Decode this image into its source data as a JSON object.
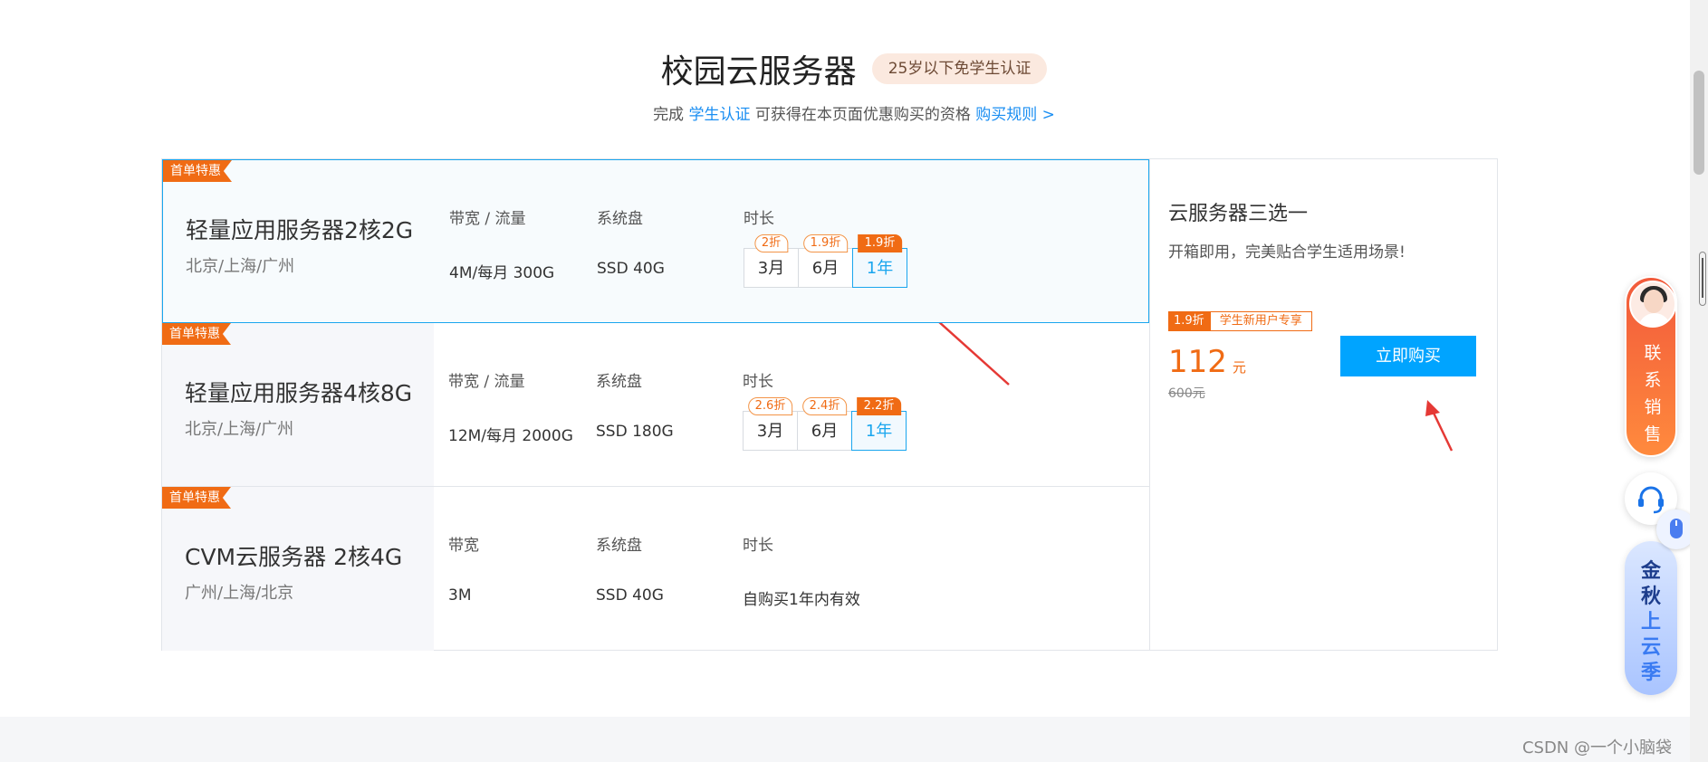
{
  "header": {
    "title": "校园云服务器",
    "age_badge": "25岁以下免学生认证",
    "subtitle_prefix": "完成",
    "subtitle_link": "学生认证",
    "subtitle_middle": "可获得在本页面优惠购买的资格",
    "rules_link": "购买规则 >"
  },
  "products": [
    {
      "ribbon": "首单特惠",
      "name": "轻量应用服务器2核2G",
      "region": "北京/上海/广州",
      "bandwidth_header": "带宽 / 流量",
      "bandwidth_value": "4M/每月 300G",
      "disk_header": "系统盘",
      "disk_value": "SSD 40G",
      "duration_header": "时长",
      "durations": [
        {
          "label": "3月",
          "discount": "2折"
        },
        {
          "label": "6月",
          "discount": "1.9折"
        },
        {
          "label": "1年",
          "discount": "1.9折"
        }
      ]
    },
    {
      "ribbon": "首单特惠",
      "name": "轻量应用服务器4核8G",
      "region": "北京/上海/广州",
      "bandwidth_header": "带宽 / 流量",
      "bandwidth_value": "12M/每月 2000G",
      "disk_header": "系统盘",
      "disk_value": "SSD 180G",
      "duration_header": "时长",
      "durations": [
        {
          "label": "3月",
          "discount": "2.6折"
        },
        {
          "label": "6月",
          "discount": "2.4折"
        },
        {
          "label": "1年",
          "discount": "2.2折"
        }
      ]
    },
    {
      "ribbon": "首单特惠",
      "name": "CVM云服务器 2核4G",
      "region": "广州/上海/北京",
      "bandwidth_header": "带宽",
      "bandwidth_value": "3M",
      "disk_header": "系统盘",
      "disk_value": "SSD 40G",
      "duration_header": "时长",
      "duration_value": "自购买1年内有效"
    }
  ],
  "side": {
    "title": "云服务器三选一",
    "desc": "开箱即用，完美贴合学生适用场景!",
    "tag_discount": "1.9折",
    "tag_user": "学生新用户专享",
    "price": "112",
    "price_unit": "元",
    "old_price": "600元",
    "buy_button": "立即购买"
  },
  "floating": {
    "sales_text": "联系销售",
    "promo_line1": "金秋",
    "promo_line2": "上云季"
  },
  "watermark": "CSDN @一个小脑袋",
  "colors": {
    "accent_orange": "#f06b14",
    "accent_blue": "#00a4ff",
    "link_blue": "#1a8ef2"
  }
}
